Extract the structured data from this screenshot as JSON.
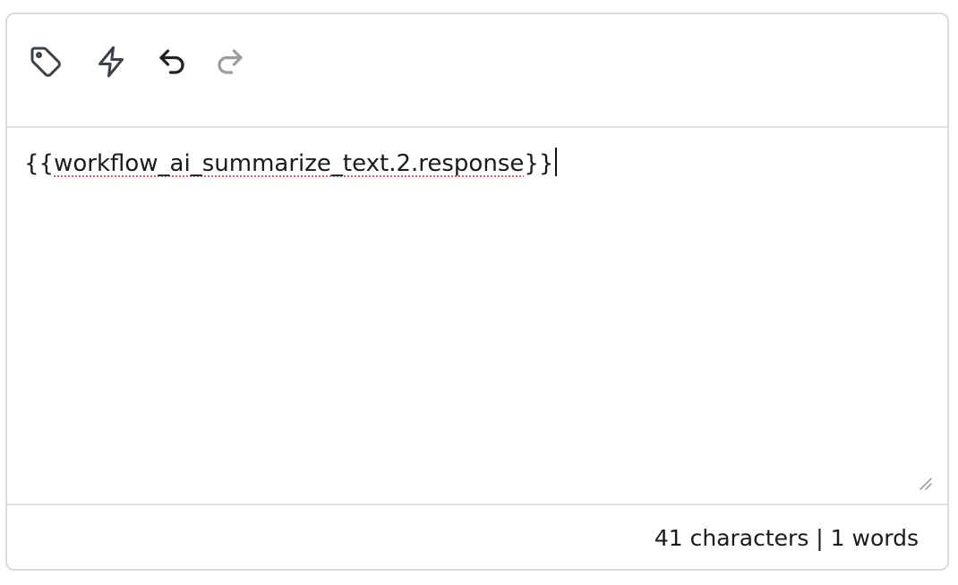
{
  "toolbar": {
    "buttons": [
      {
        "icon": "tag-icon",
        "state": "enabled"
      },
      {
        "icon": "lightning-bolt-icon",
        "state": "enabled"
      },
      {
        "icon": "undo-icon",
        "state": "enabled"
      },
      {
        "icon": "redo-icon",
        "state": "disabled"
      }
    ]
  },
  "editor": {
    "open_braces": "{{",
    "underlined_text": "workflow_ai_summarize_text.2.response",
    "close_braces": "}}"
  },
  "footer": {
    "counter": "41 characters | 1 words"
  },
  "colors": {
    "border": "#d9d9de",
    "icon": "#3c4249",
    "icon_disabled": "#9a9ea3",
    "text": "#1a1a1a",
    "spellcheck_underline": "#e05a5a"
  }
}
